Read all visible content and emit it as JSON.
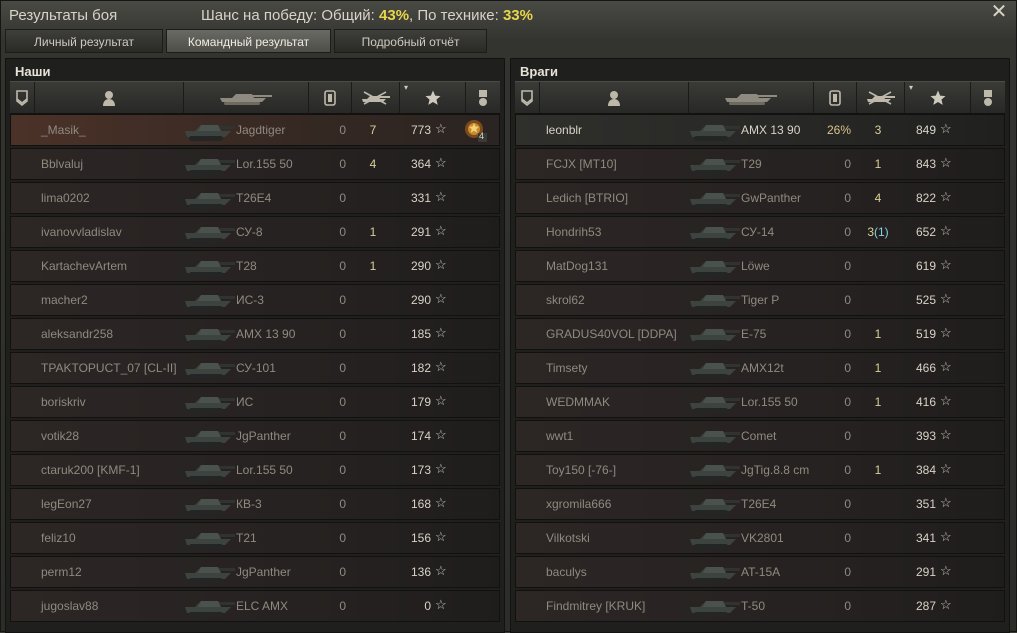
{
  "window": {
    "title": "Результаты боя",
    "close_icon": "close-icon"
  },
  "chance": {
    "prefix": "Шанс на победу: Общий: ",
    "overall": "43%",
    "middle": ", По технике: ",
    "vehicles": "33%"
  },
  "tabs": [
    {
      "label": "Личный результат",
      "active": false
    },
    {
      "label": "Командный результат",
      "active": true
    },
    {
      "label": "Подробный отчёт",
      "active": false
    }
  ],
  "left_team": {
    "title": "Наши",
    "rows": [
      {
        "name": "_Masik_",
        "tank": "Jagdtiger",
        "dmg": "0",
        "kills": "7",
        "xp": "773",
        "self": true,
        "medal": "4"
      },
      {
        "name": "Bblvaluj",
        "tank": "Lor.155 50",
        "dmg": "0",
        "kills": "4",
        "xp": "364"
      },
      {
        "name": "lima0202",
        "tank": "T26E4",
        "dmg": "0",
        "kills": "",
        "xp": "331"
      },
      {
        "name": "ivanovvladislav",
        "tank": "СУ-8",
        "dmg": "0",
        "kills": "1",
        "xp": "291"
      },
      {
        "name": "KartachevArtem",
        "tank": "T28",
        "dmg": "0",
        "kills": "1",
        "xp": "290"
      },
      {
        "name": "macher2",
        "tank": "ИС-3",
        "dmg": "0",
        "kills": "",
        "xp": "290"
      },
      {
        "name": "aleksandr258",
        "tank": "AMX 13 90",
        "dmg": "0",
        "kills": "",
        "xp": "185"
      },
      {
        "name": "TPAKTOPUCT_07 [CL-II]",
        "tank": "СУ-101",
        "dmg": "0",
        "kills": "",
        "xp": "182"
      },
      {
        "name": "boriskriv",
        "tank": "ИС",
        "dmg": "0",
        "kills": "",
        "xp": "179"
      },
      {
        "name": "votik28",
        "tank": "JgPanther",
        "dmg": "0",
        "kills": "",
        "xp": "174"
      },
      {
        "name": "ctaruk200 [KMF-1]",
        "tank": "Lor.155 50",
        "dmg": "0",
        "kills": "",
        "xp": "173"
      },
      {
        "name": "legEon27",
        "tank": "КВ-3",
        "dmg": "0",
        "kills": "",
        "xp": "168"
      },
      {
        "name": "feliz10",
        "tank": "T21",
        "dmg": "0",
        "kills": "",
        "xp": "156"
      },
      {
        "name": "perm12",
        "tank": "JgPanther",
        "dmg": "0",
        "kills": "",
        "xp": "136"
      },
      {
        "name": "jugoslav88",
        "tank": "ELC AMX",
        "dmg": "0",
        "kills": "",
        "xp": "0"
      }
    ]
  },
  "right_team": {
    "title": "Враги",
    "rows": [
      {
        "name": "leonblr",
        "tank": "AMX 13 90",
        "dmg": "26%",
        "kills": "3",
        "xp": "849",
        "top": true
      },
      {
        "name": "FCJX [MT10]",
        "tank": "T29",
        "dmg": "0",
        "kills": "1",
        "xp": "843"
      },
      {
        "name": "Ledich [BTRIO]",
        "tank": "GwPanther",
        "dmg": "0",
        "kills": "4",
        "xp": "822"
      },
      {
        "name": "Hondrih53",
        "tank": "СУ-14",
        "dmg": "0",
        "kills": "3",
        "kills_sub": "(1)",
        "xp": "652"
      },
      {
        "name": "MatDog131",
        "tank": "Löwe",
        "dmg": "0",
        "kills": "",
        "xp": "619"
      },
      {
        "name": "skrol62",
        "tank": "Tiger P",
        "dmg": "0",
        "kills": "",
        "xp": "525"
      },
      {
        "name": "GRADUS40VOL [DDPA]",
        "tank": "E-75",
        "dmg": "0",
        "kills": "1",
        "xp": "519"
      },
      {
        "name": "Timsety",
        "tank": "AMX12t",
        "dmg": "0",
        "kills": "1",
        "xp": "466"
      },
      {
        "name": "WEDMMAK",
        "tank": "Lor.155 50",
        "dmg": "0",
        "kills": "1",
        "xp": "416"
      },
      {
        "name": "wwt1",
        "tank": "Comet",
        "dmg": "0",
        "kills": "",
        "xp": "393"
      },
      {
        "name": "Toy150 [-76-]",
        "tank": "JgTig.8.8 cm",
        "dmg": "0",
        "kills": "1",
        "xp": "384"
      },
      {
        "name": "xgromila666",
        "tank": "T26E4",
        "dmg": "0",
        "kills": "",
        "xp": "351"
      },
      {
        "name": "Vilkotski",
        "tank": "VK2801",
        "dmg": "0",
        "kills": "",
        "xp": "341"
      },
      {
        "name": "baculys",
        "tank": "AT-15A",
        "dmg": "0",
        "kills": "",
        "xp": "291"
      },
      {
        "name": "Findmitrey [KRUK]",
        "tank": "T-50",
        "dmg": "0",
        "kills": "",
        "xp": "287"
      }
    ]
  },
  "header_icons": [
    "badge-icon",
    "player-icon",
    "tank-icon",
    "damage-icon",
    "kills-icon",
    "xp-star-icon",
    "medal-icon"
  ],
  "colors": {
    "accent": "#e8d64a",
    "self_row": "#4b3228",
    "kills": "#d8cf96"
  }
}
